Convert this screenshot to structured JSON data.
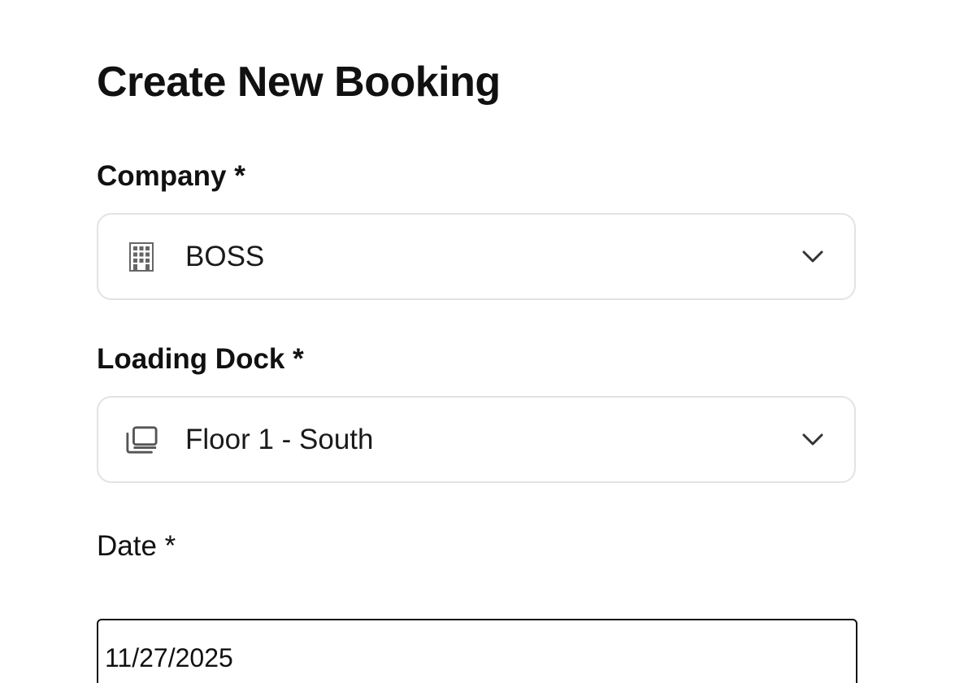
{
  "form": {
    "title": "Create New Booking",
    "company": {
      "label": "Company *",
      "value": "BOSS",
      "icon": "building-icon"
    },
    "loading_dock": {
      "label": "Loading Dock *",
      "value": "Floor 1 - South",
      "icon": "window-stack-icon"
    },
    "date": {
      "label": "Date *",
      "value": "11/27/2025"
    }
  },
  "colors": {
    "text": "#111111",
    "border": "#e3e3e3",
    "icon": "#666666",
    "date_border": "#111111"
  }
}
